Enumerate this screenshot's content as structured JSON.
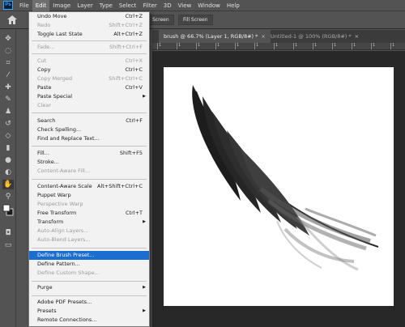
{
  "menubar": {
    "logo": "Ps",
    "items": [
      "File",
      "Edit",
      "Image",
      "Layer",
      "Type",
      "Select",
      "Filter",
      "3D",
      "View",
      "Window",
      "Help"
    ]
  },
  "options": {
    "screen_label": "Screen",
    "fill_screen_label": "Fill Screen"
  },
  "tabs": [
    {
      "label": "brush @ 66.7% (Layer 1, RGB/8#) *",
      "close": "×"
    },
    {
      "label": "Untitled-1 @ 100% (RGB/8#) *",
      "close": "×"
    }
  ],
  "ruler": {
    "labels": [
      "1",
      "1",
      "1",
      "1",
      "1",
      "1",
      "1",
      "1",
      "1",
      "1",
      "1",
      "1",
      "1"
    ]
  },
  "edit_menu": {
    "undo": {
      "label": "Undo Move",
      "shortcut": "Ctrl+Z"
    },
    "redo": {
      "label": "Redo",
      "shortcut": "Shift+Ctrl+Z"
    },
    "toggle": {
      "label": "Toggle Last State",
      "shortcut": "Alt+Ctrl+Z"
    },
    "fade": {
      "label": "Fade...",
      "shortcut": "Shift+Ctrl+F"
    },
    "cut": {
      "label": "Cut",
      "shortcut": "Ctrl+X"
    },
    "copy": {
      "label": "Copy",
      "shortcut": "Ctrl+C"
    },
    "copy_merged": {
      "label": "Copy Merged",
      "shortcut": "Shift+Ctrl+C"
    },
    "paste": {
      "label": "Paste",
      "shortcut": "Ctrl+V"
    },
    "paste_special": {
      "label": "Paste Special"
    },
    "clear": {
      "label": "Clear"
    },
    "search": {
      "label": "Search",
      "shortcut": "Ctrl+F"
    },
    "check_spelling": {
      "label": "Check Spelling..."
    },
    "find_replace": {
      "label": "Find and Replace Text..."
    },
    "fill": {
      "label": "Fill...",
      "shortcut": "Shift+F5"
    },
    "stroke": {
      "label": "Stroke..."
    },
    "content_aware_fill": {
      "label": "Content-Aware Fill..."
    },
    "content_aware_scale": {
      "label": "Content-Aware Scale",
      "shortcut": "Alt+Shift+Ctrl+C"
    },
    "puppet_warp": {
      "label": "Puppet Warp"
    },
    "perspective_warp": {
      "label": "Perspective Warp"
    },
    "free_transform": {
      "label": "Free Transform",
      "shortcut": "Ctrl+T"
    },
    "transform": {
      "label": "Transform"
    },
    "auto_align": {
      "label": "Auto-Align Layers..."
    },
    "auto_blend": {
      "label": "Auto-Blend Layers..."
    },
    "define_brush": {
      "label": "Define Brush Preset..."
    },
    "define_pattern": {
      "label": "Define Pattern..."
    },
    "define_shape": {
      "label": "Define Custom Shape..."
    },
    "purge": {
      "label": "Purge"
    },
    "pdf_presets": {
      "label": "Adobe PDF Presets..."
    },
    "presets": {
      "label": "Presets"
    },
    "remote": {
      "label": "Remote Connections..."
    }
  }
}
